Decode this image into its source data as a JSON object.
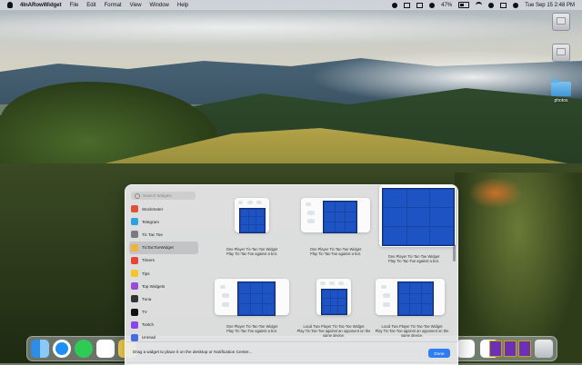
{
  "menubar": {
    "app_name": "4InARowWidget",
    "menus": [
      "File",
      "Edit",
      "Format",
      "View",
      "Window",
      "Help"
    ],
    "battery": "47%",
    "clock": "Tue Sep 15  2:48 PM"
  },
  "desktop": {
    "icons": [
      {
        "label": "",
        "kind": "disk"
      },
      {
        "label": "",
        "kind": "disk"
      },
      {
        "label": "photos",
        "kind": "folder"
      }
    ]
  },
  "widget_gallery": {
    "search_placeholder": "Search Widgets",
    "sidebar": [
      {
        "label": "Stockmeter",
        "color": "#e0533a",
        "selected": false
      },
      {
        "label": "Telegram",
        "color": "#2aa3e0",
        "selected": false
      },
      {
        "label": "Tic Tac Toe",
        "color": "#7a7a85",
        "selected": false
      },
      {
        "label": "TicTacToeWidget",
        "color": "#f0b23a",
        "selected": true
      },
      {
        "label": "Timers",
        "color": "#e8443a",
        "selected": false
      },
      {
        "label": "Tips",
        "color": "#f5c52a",
        "selected": false
      },
      {
        "label": "Top Widgets",
        "color": "#9a4ad6",
        "selected": false
      },
      {
        "label": "Tuna",
        "color": "#333333",
        "selected": false
      },
      {
        "label": "TV",
        "color": "#111111",
        "selected": false
      },
      {
        "label": "Twitch",
        "color": "#8a44e8",
        "selected": false
      },
      {
        "label": "Unread",
        "color": "#4a6ae0",
        "selected": false
      }
    ],
    "widgets": [
      {
        "caption1": "One Player Tic-Tac-Toe Widget",
        "caption2": "Play Tic-Tac-Toe against a bot."
      },
      {
        "caption1": "One Player Tic-Tac-Toe Widget",
        "caption2": "Play Tic-Tac-Toe against a bot."
      },
      {
        "caption1": "One Player Tic-Tac-Toe Widget",
        "caption2": "Play Tic-Tac-Toe against a bot."
      },
      {
        "caption1": "One Player Tic-Tac-Toe Widget",
        "caption2": "Play Tic-Tac-Toe against a bot."
      },
      {
        "caption1": "Local Two Player Tic-Tac-Toe Widget",
        "caption2": "Play Tic-Tac-Toe against an opponent on the same device."
      },
      {
        "caption1": "Local Two Player Tic-Tac-Toe Widget",
        "caption2": "Play Tic-Tac-Toe against an opponent on the same device."
      }
    ],
    "footer_text": "Drag a widget to place it on the desktop or Notification Center...",
    "done_label": "Done",
    "grid_color": "#1e53c4"
  }
}
